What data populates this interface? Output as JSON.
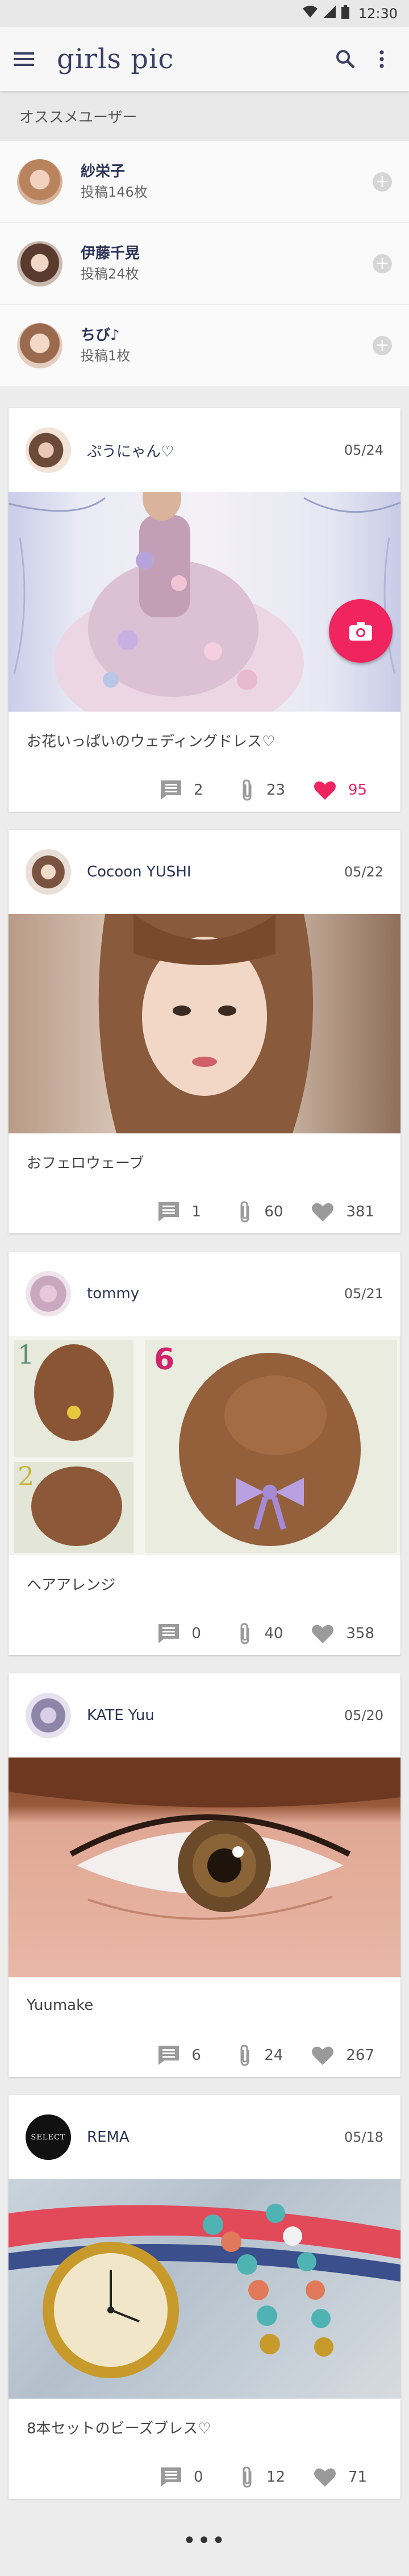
{
  "status_bar": {
    "time": "12:30"
  },
  "app": {
    "title": "girls pic"
  },
  "recommended": {
    "header": "オススメユーザー",
    "users": [
      {
        "name": "紗栄子",
        "posts": "投稿146枚"
      },
      {
        "name": "伊藤千晃",
        "posts": "投稿24枚"
      },
      {
        "name": "ちび♪",
        "posts": "投稿1枚"
      }
    ]
  },
  "posts": [
    {
      "user": "ぷうにゃん♡",
      "date": "05/24",
      "caption": "お花いっぱいのウェディングドレス♡",
      "comments": "2",
      "clips": "23",
      "likes": "95",
      "liked": true
    },
    {
      "user": "Cocoon YUSHI",
      "date": "05/22",
      "caption": "おフェロウェーブ",
      "comments": "1",
      "clips": "60",
      "likes": "381",
      "liked": false
    },
    {
      "user": "tommy",
      "date": "05/21",
      "caption": "ヘアアレンジ",
      "comments": "0",
      "clips": "40",
      "likes": "358",
      "liked": false
    },
    {
      "user": "KATE Yuu",
      "date": "05/20",
      "caption": "Yuumake",
      "comments": "6",
      "clips": "24",
      "likes": "267",
      "liked": false
    },
    {
      "user": "REMA",
      "date": "05/18",
      "caption": "8本セットのビーズブレス♡",
      "comments": "0",
      "clips": "12",
      "likes": "71",
      "liked": false
    }
  ],
  "image_labels": {
    "step1": "1",
    "step2": "2",
    "step6": "6",
    "rema_logo": "SELECT"
  },
  "colors": {
    "accent": "#f0245f",
    "title": "#3a3f63",
    "like_active": "#f0245f",
    "like_inactive": "#9a9a9a"
  },
  "footer": {
    "more": "•••"
  }
}
